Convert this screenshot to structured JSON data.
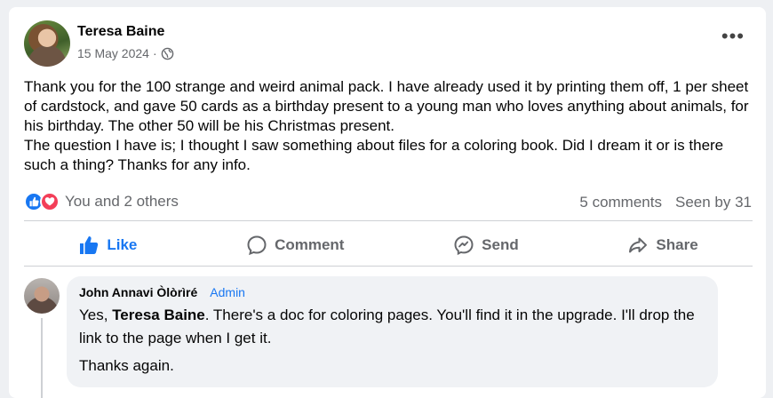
{
  "post": {
    "author": "Teresa Baine",
    "date": "15 May 2024",
    "separator": "·",
    "privacy_icon": "globe-icon",
    "more_label": "•••",
    "text_p1": "Thank you for the 100 strange and weird animal pack.  I have already used it by printing them off, 1 per sheet of cardstock, and gave 50 cards as a birthday present to a young man who loves anything about animals, for his birthday.  The other 50 will be his Christmas present.",
    "text_p2": "The question I have is; I thought I saw something about files for a coloring book.  Did I dream it or is there such a thing?  Thanks for any info.",
    "reactions_text": "You and 2 others",
    "comments_count": "5 comments",
    "seen_by": "Seen by 31"
  },
  "actions": {
    "like": "Like",
    "comment": "Comment",
    "send": "Send",
    "share": "Share"
  },
  "comment": {
    "author": "John Annavi Òlòrìré",
    "badge": "Admin",
    "text_pre": "Yes, ",
    "mention": "Teresa Baine",
    "text_post": ". There's a doc for coloring pages. You'll find it in the upgrade. I'll drop the link to the page when I get it.",
    "text2": "Thanks again."
  },
  "colors": {
    "accent": "#1877f2",
    "love": "#f33e58",
    "muted": "#65676b"
  }
}
